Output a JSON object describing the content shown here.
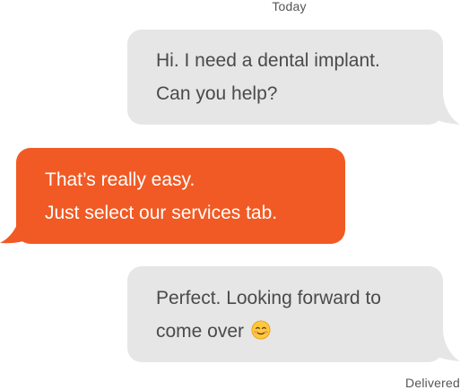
{
  "conversation": {
    "date_separator": "Today",
    "messages": [
      {
        "sender": "user",
        "lines": [
          "Hi. I need a dental implant.",
          "Can you help?"
        ]
      },
      {
        "sender": "business",
        "lines": [
          "That’s really easy.",
          "Just select our services tab."
        ]
      },
      {
        "sender": "user",
        "lines": [
          "Perfect. Looking forward to",
          "come over"
        ],
        "emoji": "smiling-face-icon"
      }
    ],
    "status": "Delivered"
  },
  "colors": {
    "incoming_bubble": "#e6e6e6",
    "outgoing_bubble": "#f15a24",
    "incoming_text": "#4a4a4a",
    "outgoing_text": "#ffffff",
    "meta_text": "#555555"
  }
}
